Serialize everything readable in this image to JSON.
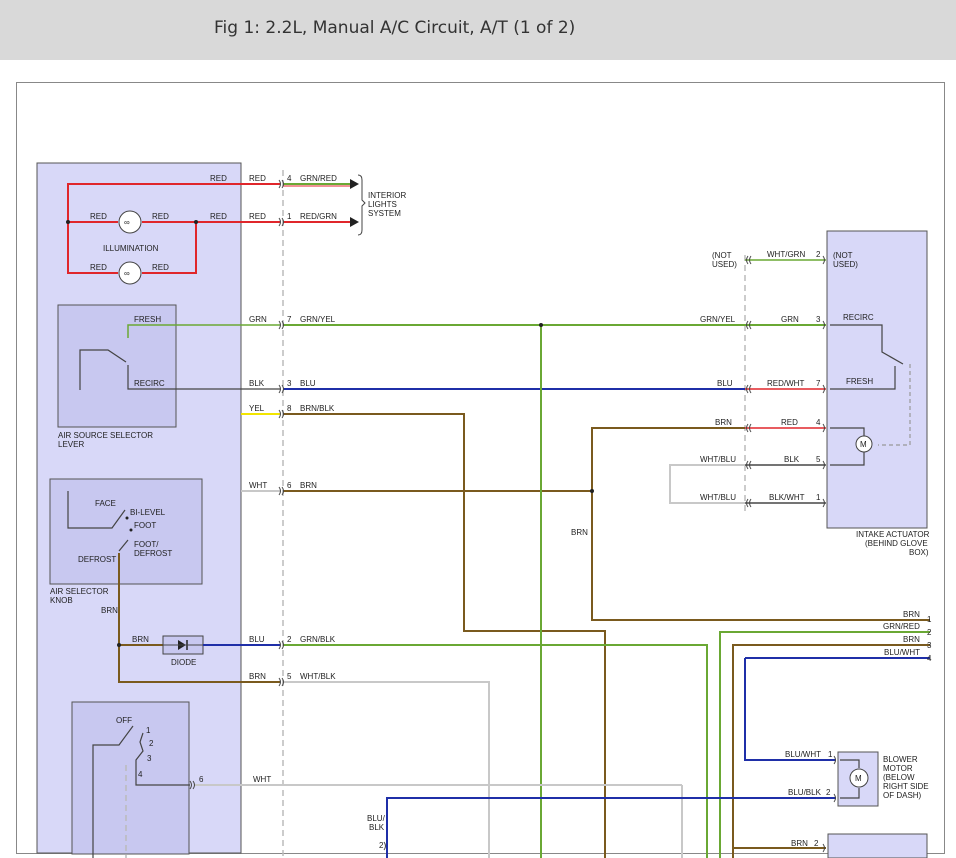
{
  "header": {
    "title": "Fig 1: 2.2L, Manual A/C Circuit, A/T (1 of 2)"
  },
  "colors": {
    "red": "#e0262b",
    "green": "#6aa834",
    "blue": "#1f2fa8",
    "yellow": "#f2e500",
    "brown": "#7a5a1e",
    "white": "#c8c8c8",
    "black": "#222222",
    "panel": "#d8d8f8"
  },
  "left_panel": {
    "illumination": "ILLUMINATION",
    "air_source_lever": [
      "AIR SOURCE SELECTOR",
      "LEVER"
    ],
    "fresh": "FRESH",
    "recirc": "RECIRC",
    "face": "FACE",
    "bi_level": "BI-LEVEL",
    "foot": "FOOT",
    "foot_defrost": [
      "FOOT/",
      "DEFROST"
    ],
    "defrost": "DEFROST",
    "air_selector_knob": [
      "AIR SELECTOR",
      "KNOB"
    ],
    "diode": "DIODE",
    "blower_switch": {
      "off": "OFF",
      "pos1": "1",
      "pos2": "2",
      "pos3": "3",
      "pos4": "4"
    }
  },
  "wires_left": {
    "red1": "RED",
    "red_a": "RED",
    "red_b": "RED",
    "red_c": "RED",
    "red_d": "RED",
    "red_e": "RED",
    "red_f": "RED",
    "red_to4": "RED",
    "red_to1": "RED",
    "grn": "GRN",
    "blk": "BLK",
    "yel": "YEL",
    "wht": "WHT",
    "brn_a": "BRN",
    "brn_b": "BRN",
    "brn_c": "BRN",
    "blu": "BLU",
    "wht6": "WHT"
  },
  "connector_c1": [
    {
      "pin": "4",
      "wire": "GRN/RED"
    },
    {
      "pin": "1",
      "wire": "RED/GRN"
    },
    {
      "pin": "7",
      "wire": "GRN/YEL"
    },
    {
      "pin": "3",
      "wire": "BLU"
    },
    {
      "pin": "8",
      "wire": "BRN/BLK"
    },
    {
      "pin": "6",
      "wire": "BRN"
    },
    {
      "pin": "2",
      "wire": "GRN/BLK"
    },
    {
      "pin": "5",
      "wire": "WHT/BLK"
    },
    {
      "pin": "6",
      "wire": "WHT"
    }
  ],
  "interior_lights": [
    "INTERIOR",
    "LIGHTS",
    "SYSTEM"
  ],
  "intake_actuator": {
    "not_used_left": [
      "(NOT",
      "USED)"
    ],
    "not_used_right": [
      "(NOT",
      "USED)"
    ],
    "recirc": "RECIRC",
    "fresh": "FRESH",
    "motor": "M",
    "name": [
      "INTAKE ACTUATOR",
      "(BEHIND GLOVE",
      "BOX)"
    ],
    "pins": [
      {
        "pin": "2",
        "outer": "WHT/GRN",
        "inner": ""
      },
      {
        "pin": "3",
        "outer": "GRN/YEL",
        "inner": "GRN"
      },
      {
        "pin": "7",
        "outer": "BLU",
        "inner": "RED/WHT"
      },
      {
        "pin": "4",
        "outer": "BRN",
        "inner": "RED"
      },
      {
        "pin": "5",
        "outer": "WHT/BLU",
        "inner": "BLK"
      },
      {
        "pin": "1",
        "outer": "WHT/BLU",
        "inner": "BLK/WHT"
      }
    ]
  },
  "right_edge": [
    {
      "wire": "BRN",
      "pin": "1"
    },
    {
      "wire": "GRN/RED",
      "pin": "2"
    },
    {
      "wire": "BRN",
      "pin": "3"
    },
    {
      "wire": "BLU/WHT",
      "pin": "4"
    }
  ],
  "brn_mid": "BRN",
  "blower_motor": {
    "name": [
      "BLOWER",
      "MOTOR",
      "(BELOW",
      "RIGHT SIDE",
      "OF DASH)"
    ],
    "motor": "M",
    "pin1_wire": "BLU/WHT",
    "pin1": "1",
    "pin2_wire": "BLU/BLK",
    "pin2": "2"
  },
  "bottom": {
    "blu_blk": [
      "BLU/",
      "BLK"
    ],
    "pin2": "2",
    "brn2": "BRN",
    "brn2_pin": "2"
  }
}
